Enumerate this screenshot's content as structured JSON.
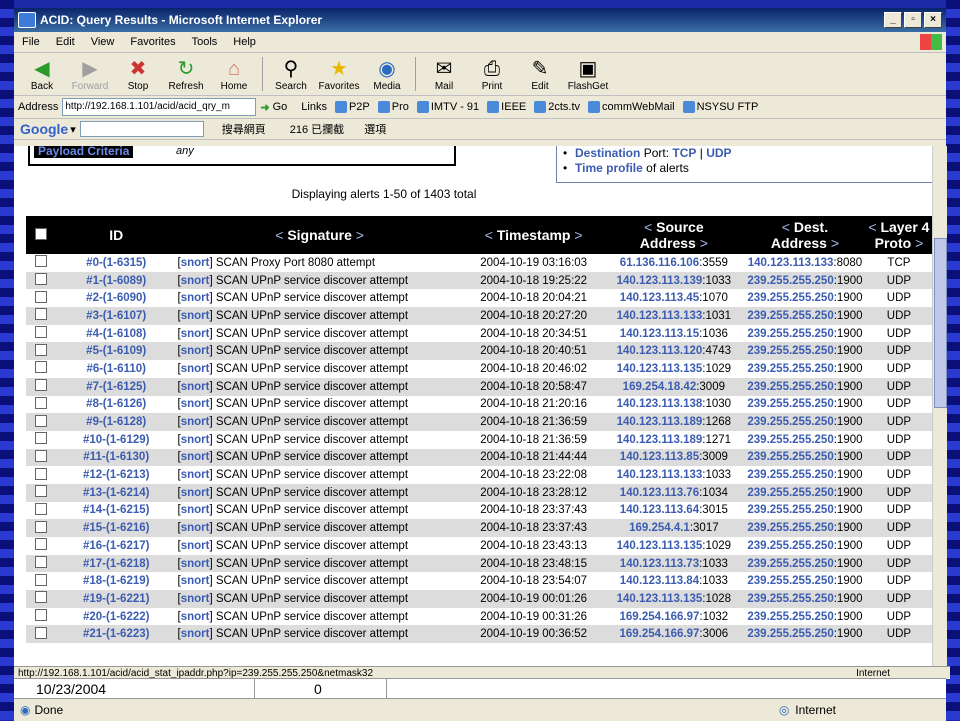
{
  "window": {
    "title": "ACID: Query Results - Microsoft Internet Explorer"
  },
  "menu": [
    "File",
    "Edit",
    "View",
    "Favorites",
    "Tools",
    "Help"
  ],
  "toolbar": [
    {
      "label": "Back",
      "icon": "back-icon",
      "glyph": "◀"
    },
    {
      "label": "Forward",
      "icon": "forward-icon",
      "glyph": "▶"
    },
    {
      "label": "Stop",
      "icon": "stop-icon",
      "glyph": "✖"
    },
    {
      "label": "Refresh",
      "icon": "refresh-icon",
      "glyph": "↻"
    },
    {
      "label": "Home",
      "icon": "home-icon",
      "glyph": "⌂"
    },
    {
      "label": "Search",
      "icon": "search-icon",
      "glyph": "⚲"
    },
    {
      "label": "Favorites",
      "icon": "star-icon",
      "glyph": "★"
    },
    {
      "label": "Media",
      "icon": "media-icon",
      "glyph": "◉"
    },
    {
      "label": "Mail",
      "icon": "mail-icon",
      "glyph": "✉"
    },
    {
      "label": "Print",
      "icon": "print-icon",
      "glyph": "⎙"
    },
    {
      "label": "Edit",
      "icon": "edit-icon",
      "glyph": "✎"
    },
    {
      "label": "FlashGet",
      "icon": "flashget-icon",
      "glyph": "▣"
    }
  ],
  "address": {
    "label": "Address",
    "value": "http://192.168.1.101/acid/acid_qry_m",
    "go": "Go"
  },
  "links": {
    "label": "Links",
    "items": [
      "P2P",
      "Pro",
      "IMTV - 91",
      "IEEE",
      "2cts.tv",
      "commWebMail",
      "NSYSU FTP"
    ]
  },
  "googlebar": {
    "logo": "Google",
    "search_btn": "搜尋網頁",
    "blocked": "216 已攔截",
    "options": "選項"
  },
  "payload": {
    "label": "Payload Criteria",
    "value": "any"
  },
  "criteria_links": {
    "dest_text": "Destination",
    "port_text": "Port:",
    "tcp": "TCP",
    "sep": "|",
    "udp": "UDP",
    "time_profile": "Time profile",
    "of_alerts": "of alerts"
  },
  "displaying": "Displaying alerts 1-50 of 1403 total",
  "table": {
    "headers": {
      "id": "ID",
      "sig": "Signature",
      "ts": "Timestamp",
      "src1": "Source",
      "src2": "Address",
      "dst1": "Dest.",
      "dst2": "Address",
      "l4a": "Layer 4",
      "l4b": "Proto",
      "lt": "<",
      "gt": ">"
    },
    "rows": [
      {
        "id": "#0-(1-6315)",
        "sig": "SCAN Proxy Port 8080 attempt",
        "ts": "2004-10-19 03:16:03",
        "src": "61.136.116.106",
        "sport": ":3559",
        "dst": "140.123.113.133",
        "dport": ":8080",
        "proto": "TCP"
      },
      {
        "id": "#1-(1-6089)",
        "sig": "SCAN UPnP service discover attempt",
        "ts": "2004-10-18 19:25:22",
        "src": "140.123.113.139",
        "sport": ":1033",
        "dst": "239.255.255.250",
        "dport": ":1900",
        "proto": "UDP"
      },
      {
        "id": "#2-(1-6090)",
        "sig": "SCAN UPnP service discover attempt",
        "ts": "2004-10-18 20:04:21",
        "src": "140.123.113.45",
        "sport": ":1070",
        "dst": "239.255.255.250",
        "dport": ":1900",
        "proto": "UDP"
      },
      {
        "id": "#3-(1-6107)",
        "sig": "SCAN UPnP service discover attempt",
        "ts": "2004-10-18 20:27:20",
        "src": "140.123.113.133",
        "sport": ":1031",
        "dst": "239.255.255.250",
        "dport": ":1900",
        "proto": "UDP"
      },
      {
        "id": "#4-(1-6108)",
        "sig": "SCAN UPnP service discover attempt",
        "ts": "2004-10-18 20:34:51",
        "src": "140.123.113.15",
        "sport": ":1036",
        "dst": "239.255.255.250",
        "dport": ":1900",
        "proto": "UDP"
      },
      {
        "id": "#5-(1-6109)",
        "sig": "SCAN UPnP service discover attempt",
        "ts": "2004-10-18 20:40:51",
        "src": "140.123.113.120",
        "sport": ":4743",
        "dst": "239.255.255.250",
        "dport": ":1900",
        "proto": "UDP"
      },
      {
        "id": "#6-(1-6110)",
        "sig": "SCAN UPnP service discover attempt",
        "ts": "2004-10-18 20:46:02",
        "src": "140.123.113.135",
        "sport": ":1029",
        "dst": "239.255.255.250",
        "dport": ":1900",
        "proto": "UDP"
      },
      {
        "id": "#7-(1-6125)",
        "sig": "SCAN UPnP service discover attempt",
        "ts": "2004-10-18 20:58:47",
        "src": "169.254.18.42",
        "sport": ":3009",
        "dst": "239.255.255.250",
        "dport": ":1900",
        "proto": "UDP"
      },
      {
        "id": "#8-(1-6126)",
        "sig": "SCAN UPnP service discover attempt",
        "ts": "2004-10-18 21:20:16",
        "src": "140.123.113.138",
        "sport": ":1030",
        "dst": "239.255.255.250",
        "dport": ":1900",
        "proto": "UDP"
      },
      {
        "id": "#9-(1-6128)",
        "sig": "SCAN UPnP service discover attempt",
        "ts": "2004-10-18 21:36:59",
        "src": "140.123.113.189",
        "sport": ":1268",
        "dst": "239.255.255.250",
        "dport": ":1900",
        "proto": "UDP"
      },
      {
        "id": "#10-(1-6129)",
        "sig": "SCAN UPnP service discover attempt",
        "ts": "2004-10-18 21:36:59",
        "src": "140.123.113.189",
        "sport": ":1271",
        "dst": "239.255.255.250",
        "dport": ":1900",
        "proto": "UDP"
      },
      {
        "id": "#11-(1-6130)",
        "sig": "SCAN UPnP service discover attempt",
        "ts": "2004-10-18 21:44:44",
        "src": "140.123.113.85",
        "sport": ":3009",
        "dst": "239.255.255.250",
        "dport": ":1900",
        "proto": "UDP"
      },
      {
        "id": "#12-(1-6213)",
        "sig": "SCAN UPnP service discover attempt",
        "ts": "2004-10-18 23:22:08",
        "src": "140.123.113.133",
        "sport": ":1033",
        "dst": "239.255.255.250",
        "dport": ":1900",
        "proto": "UDP"
      },
      {
        "id": "#13-(1-6214)",
        "sig": "SCAN UPnP service discover attempt",
        "ts": "2004-10-18 23:28:12",
        "src": "140.123.113.76",
        "sport": ":1034",
        "dst": "239.255.255.250",
        "dport": ":1900",
        "proto": "UDP"
      },
      {
        "id": "#14-(1-6215)",
        "sig": "SCAN UPnP service discover attempt",
        "ts": "2004-10-18 23:37:43",
        "src": "140.123.113.64",
        "sport": ":3015",
        "dst": "239.255.255.250",
        "dport": ":1900",
        "proto": "UDP"
      },
      {
        "id": "#15-(1-6216)",
        "sig": "SCAN UPnP service discover attempt",
        "ts": "2004-10-18 23:37:43",
        "src": "169.254.4.1",
        "sport": ":3017",
        "dst": "239.255.255.250",
        "dport": ":1900",
        "proto": "UDP"
      },
      {
        "id": "#16-(1-6217)",
        "sig": "SCAN UPnP service discover attempt",
        "ts": "2004-10-18 23:43:13",
        "src": "140.123.113.135",
        "sport": ":1029",
        "dst": "239.255.255.250",
        "dport": ":1900",
        "proto": "UDP"
      },
      {
        "id": "#17-(1-6218)",
        "sig": "SCAN UPnP service discover attempt",
        "ts": "2004-10-18 23:48:15",
        "src": "140.123.113.73",
        "sport": ":1033",
        "dst": "239.255.255.250",
        "dport": ":1900",
        "proto": "UDP"
      },
      {
        "id": "#18-(1-6219)",
        "sig": "SCAN UPnP service discover attempt",
        "ts": "2004-10-18 23:54:07",
        "src": "140.123.113.84",
        "sport": ":1033",
        "dst": "239.255.255.250",
        "dport": ":1900",
        "proto": "UDP"
      },
      {
        "id": "#19-(1-6221)",
        "sig": "SCAN UPnP service discover attempt",
        "ts": "2004-10-19 00:01:26",
        "src": "140.123.113.135",
        "sport": ":1028",
        "dst": "239.255.255.250",
        "dport": ":1900",
        "proto": "UDP"
      },
      {
        "id": "#20-(1-6222)",
        "sig": "SCAN UPnP service discover attempt",
        "ts": "2004-10-19 00:31:26",
        "src": "169.254.166.97",
        "sport": ":1032",
        "dst": "239.255.255.250",
        "dport": ":1900",
        "proto": "UDP"
      },
      {
        "id": "#21-(1-6223)",
        "sig": "SCAN UPnP service discover attempt",
        "ts": "2004-10-19 00:36:52",
        "src": "169.254.166.97",
        "sport": ":3006",
        "dst": "239.255.255.250",
        "dport": ":1900",
        "proto": "UDP"
      }
    ],
    "snort": "snort"
  },
  "statusurl": "http://192.168.1.101/acid/acid_stat_ipaddr.php?ip=239.255.255.250&netmask32",
  "status_zone": "Internet",
  "sheet": {
    "date": "10/23/2004",
    "num": "0"
  },
  "statusbar": {
    "text": "Done",
    "zone": "Internet"
  }
}
